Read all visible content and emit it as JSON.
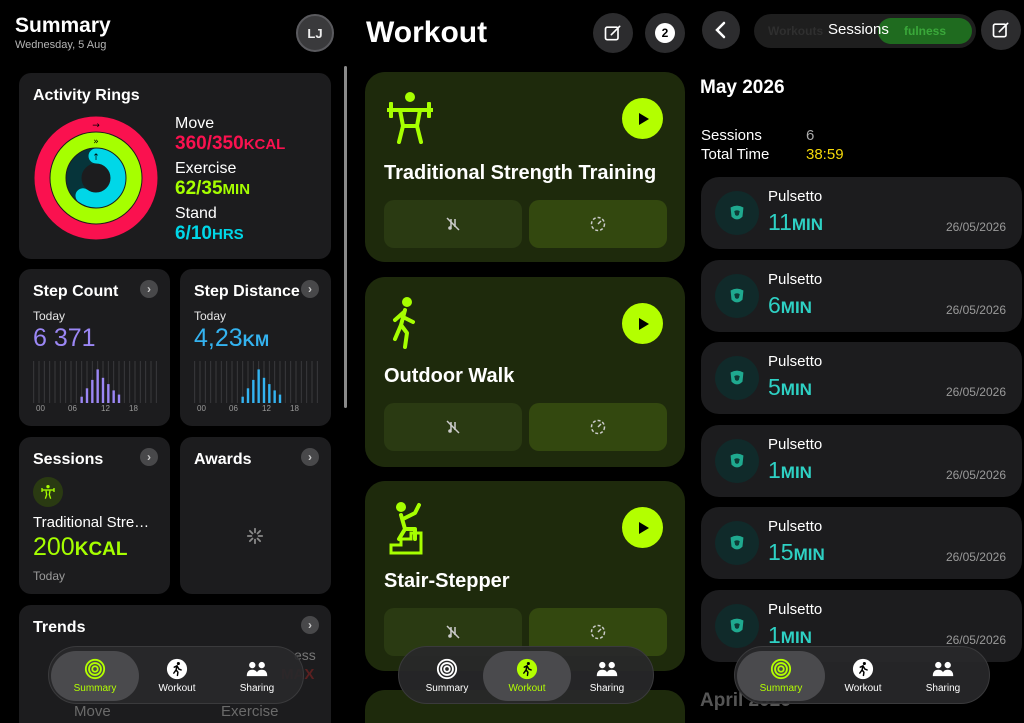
{
  "summary": {
    "title": "Summary",
    "date": "Wednesday, 5 Aug",
    "avatar_initials": "LJ",
    "activity": {
      "title": "Activity Rings",
      "move_label": "Move",
      "move_value": "360/350",
      "move_unit": "KCAL",
      "move_color": "#fa114f",
      "exercise_label": "Exercise",
      "exercise_value": "62/35",
      "exercise_unit": "MIN",
      "exercise_color": "#a6ff00",
      "stand_label": "Stand",
      "stand_value": "6/10",
      "stand_unit": "HRS",
      "stand_color": "#00d7e8",
      "move_progress": 1.03,
      "exercise_progress": 1.77,
      "stand_progress": 0.6
    },
    "step_count": {
      "title": "Step Count",
      "sub": "Today",
      "value": "6 371",
      "unit": "",
      "color": "#9b87f5",
      "ticks": [
        "00",
        "06",
        "12",
        "18"
      ],
      "hourly": [
        0,
        0,
        0,
        0,
        0,
        0,
        0,
        0,
        0,
        0.15,
        0.35,
        0.55,
        0.8,
        0.6,
        0.45,
        0.3,
        0.2,
        0,
        0,
        0,
        0,
        0,
        0,
        0
      ]
    },
    "step_distance": {
      "title": "Step Distance",
      "sub": "Today",
      "value": "4,23",
      "unit": "KM",
      "color": "#34b3f0",
      "ticks": [
        "00",
        "06",
        "12",
        "18"
      ],
      "hourly": [
        0,
        0,
        0,
        0,
        0,
        0,
        0,
        0,
        0,
        0.15,
        0.35,
        0.55,
        0.8,
        0.6,
        0.45,
        0.3,
        0.2,
        0,
        0,
        0,
        0,
        0,
        0,
        0
      ]
    },
    "sessions": {
      "title": "Sessions",
      "name": "Traditional Stre…",
      "value": "200",
      "unit": "KCAL",
      "sub": "Today"
    },
    "awards": {
      "title": "Awards"
    },
    "trends": {
      "title": "Trends",
      "left_label": "Move",
      "right_label": "Exercise",
      "right_top": "ess",
      "right_mid": "MAX"
    }
  },
  "workout": {
    "title": "Workout",
    "badge": "2",
    "cards": [
      {
        "name": "Traditional Strength Training",
        "icon": "strength-icon"
      },
      {
        "name": "Outdoor Walk",
        "icon": "walk-icon"
      },
      {
        "name": "Stair-Stepper",
        "icon": "stair-icon"
      }
    ]
  },
  "sessions_page": {
    "title": "Sessions",
    "seg_left": "Workouts",
    "seg_right": "fulness",
    "month": "May 2026",
    "next_month": "April 2026",
    "sessions_label": "Sessions",
    "sessions_count": "6",
    "total_label": "Total Time",
    "total_value": "38:59",
    "items": [
      {
        "name": "Pulsetto",
        "value": "11",
        "unit": "MIN",
        "date": "26/05/2026"
      },
      {
        "name": "Pulsetto",
        "value": "6",
        "unit": "MIN",
        "date": "26/05/2026"
      },
      {
        "name": "Pulsetto",
        "value": "5",
        "unit": "MIN",
        "date": "26/05/2026"
      },
      {
        "name": "Pulsetto",
        "value": "1",
        "unit": "MIN",
        "date": "26/05/2026"
      },
      {
        "name": "Pulsetto",
        "value": "15",
        "unit": "MIN",
        "date": "26/05/2026"
      },
      {
        "name": "Pulsetto",
        "value": "1",
        "unit": "MIN",
        "date": "26/05/2026"
      }
    ]
  },
  "tabs": {
    "summary": "Summary",
    "workout": "Workout",
    "sharing": "Sharing"
  },
  "colors": {
    "accent": "#b3ff00",
    "teal": "#2ed1c4",
    "yellow": "#f5d90a"
  }
}
